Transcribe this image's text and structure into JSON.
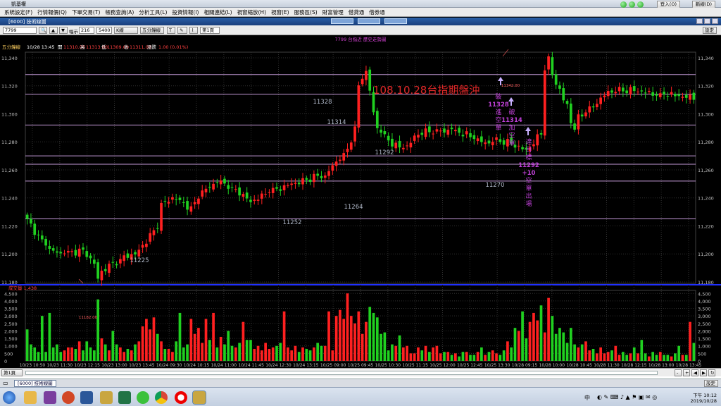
{
  "window": {
    "title": "凱基權",
    "sub_title": "[6000] 技術線圖",
    "settings_btn": "設定"
  },
  "menu": [
    "系統設定(F)",
    "行情報價(Q)",
    "下單交易(T)",
    "帳務查詢(A)",
    "分析工具(L)",
    "投資情報(I)",
    "相關連結(L)",
    "視窗縮放(H)",
    "視窗(E)",
    "服務區(S)",
    "財富管理",
    "借貸通",
    "借券通"
  ],
  "top_buttons": {
    "login": "登入(O)",
    "logout": "斷線(D)"
  },
  "toolbar": {
    "symbol": "7799",
    "period_label": "幅示",
    "bars": "216",
    "bars2": "5400",
    "kline": "K線",
    "freq": "五分鐘線",
    "sheet": "第1頁",
    "settings": "設定"
  },
  "chart_header": "7799 台指近  歷史走勢圖",
  "info_line": {
    "freq": "五分鐘線",
    "time": "10/28 13:45",
    "open_label": "開",
    "open": "11310.00",
    "high_label": "高",
    "high": "11313.00",
    "low_label": "低",
    "low": "11309.00",
    "close_label": "收",
    "close": "11311.00",
    "chg_label": "漲跌",
    "chg": "1.00 (0.01%)"
  },
  "annotation_title": "108.10.28台指期盤沖",
  "annotations": {
    "break_1328": [
      "破",
      "11328",
      "進",
      "空",
      "單"
    ],
    "break_1314": [
      "破",
      "11314",
      "加",
      "空",
      "單"
    ],
    "target": [
      "達",
      "目",
      "標",
      "11292",
      "+10",
      "空",
      "單",
      "出",
      "場"
    ]
  },
  "price_labels": [
    {
      "text": "11328",
      "x": 458,
      "y": 97
    },
    {
      "text": "11314",
      "x": 478,
      "y": 126
    },
    {
      "text": "11292",
      "x": 546,
      "y": 169
    },
    {
      "text": "11270",
      "x": 703,
      "y": 215
    },
    {
      "text": "11264",
      "x": 502,
      "y": 246
    },
    {
      "text": "11252",
      "x": 415,
      "y": 268
    },
    {
      "text": "11225",
      "x": 198,
      "y": 322
    },
    {
      "text": "11182.00",
      "x": 125,
      "y": 402
    },
    {
      "text": "11342.00",
      "x": 725,
      "y": 73
    }
  ],
  "volume_label": "成交量 1,438",
  "y_ticks": [
    "11,340",
    "11,320",
    "11,300",
    "11,280",
    "11,260",
    "11,240",
    "11,220",
    "11,200",
    "11,180"
  ],
  "vol_ticks": [
    "4,500",
    "4,000",
    "3,500",
    "3,000",
    "2,500",
    "2,000",
    "1,500",
    "1,000",
    "500",
    "0"
  ],
  "x_ticks": [
    "10/23 10:50",
    "10/23 11:30",
    "10/23 12:15",
    "10/23 13:00",
    "10/23 13:45",
    "10/24 09:30",
    "10/24 10:15",
    "10/24 11:00",
    "10/24 11:45",
    "10/24 12:30",
    "10/24 13:15",
    "10/25 09:00",
    "10/25 09:45",
    "10/25 10:30",
    "10/25 11:15",
    "10/25 12:00",
    "10/25 12:45",
    "10/25 13:30",
    "10/28 09:15",
    "10/28 10:00",
    "10/28 10:45",
    "10/28 11:30",
    "10/28 12:15",
    "10/28 13:00",
    "10/28 13:45"
  ],
  "status_page": "第1頁",
  "bottom_tab": "[6000] 技術線圖",
  "clock": {
    "time": "下午 10:12",
    "date": "2019/10/28"
  },
  "taskbar_tray": "中",
  "chart_data": {
    "type": "candlestick",
    "title": "7799 台指近 歷史走勢圖",
    "ylim": [
      11180,
      11345
    ],
    "volume_ylim": [
      0,
      4700
    ],
    "horizontal_lines": [
      11328,
      11314,
      11292,
      11270,
      11264,
      11252,
      11225
    ],
    "anchors": [
      [
        0,
        11225
      ],
      [
        3,
        11212
      ],
      [
        6,
        11203
      ],
      [
        9,
        11200
      ],
      [
        12,
        11201
      ],
      [
        15,
        11203
      ],
      [
        18,
        11193
      ],
      [
        19,
        11182
      ],
      [
        20,
        11188
      ],
      [
        23,
        11193
      ],
      [
        26,
        11198
      ],
      [
        29,
        11200
      ],
      [
        31,
        11206
      ],
      [
        33,
        11213
      ],
      [
        34,
        11216
      ],
      [
        35,
        11218
      ],
      [
        36,
        11235
      ],
      [
        39,
        11240
      ],
      [
        42,
        11236
      ],
      [
        44,
        11232
      ],
      [
        46,
        11242
      ],
      [
        49,
        11248
      ],
      [
        51,
        11252
      ],
      [
        54,
        11249
      ],
      [
        57,
        11244
      ],
      [
        60,
        11237
      ],
      [
        62,
        11240
      ],
      [
        65,
        11244
      ],
      [
        68,
        11247
      ],
      [
        71,
        11250
      ],
      [
        74,
        11252
      ],
      [
        77,
        11255
      ],
      [
        80,
        11256
      ],
      [
        83,
        11266
      ],
      [
        86,
        11275
      ],
      [
        88,
        11289
      ],
      [
        89,
        11320
      ],
      [
        91,
        11330
      ],
      [
        92,
        11317
      ],
      [
        93,
        11300
      ],
      [
        94,
        11290
      ],
      [
        96,
        11283
      ],
      [
        98,
        11279
      ],
      [
        100,
        11276
      ],
      [
        102,
        11277
      ],
      [
        104,
        11283
      ],
      [
        106,
        11287
      ],
      [
        108,
        11287
      ],
      [
        110,
        11289
      ],
      [
        112,
        11287
      ],
      [
        114,
        11290
      ],
      [
        116,
        11287
      ],
      [
        118,
        11285
      ],
      [
        120,
        11282
      ],
      [
        122,
        11280
      ],
      [
        124,
        11279
      ],
      [
        126,
        11281
      ],
      [
        128,
        11280
      ],
      [
        130,
        11279
      ],
      [
        132,
        11276
      ],
      [
        134,
        11274
      ],
      [
        135,
        11276
      ],
      [
        137,
        11283
      ],
      [
        138,
        11286
      ],
      [
        139,
        11333
      ],
      [
        140,
        11341
      ],
      [
        141,
        11328
      ],
      [
        142,
        11322
      ],
      [
        143,
        11317
      ],
      [
        144,
        11310
      ],
      [
        145,
        11307
      ],
      [
        146,
        11294
      ],
      [
        147,
        11290
      ],
      [
        148,
        11297
      ],
      [
        150,
        11301
      ],
      [
        152,
        11305
      ],
      [
        154,
        11311
      ],
      [
        156,
        11315
      ],
      [
        158,
        11317
      ],
      [
        160,
        11316
      ],
      [
        162,
        11317
      ],
      [
        165,
        11316
      ],
      [
        168,
        11314
      ],
      [
        171,
        11315
      ],
      [
        174,
        11313
      ],
      [
        177,
        11312
      ],
      [
        180,
        11311
      ],
      [
        183,
        11310
      ],
      [
        185,
        11311
      ]
    ],
    "volumes": [
      2100,
      1100,
      900,
      600,
      3000,
      600,
      3200,
      900,
      1100,
      600,
      700,
      900,
      900,
      800,
      1300,
      700,
      1300,
      900,
      700,
      4100,
      1500,
      1100,
      700,
      2000,
      1100,
      900,
      600,
      800,
      700,
      1100,
      1300,
      2300,
      2800,
      2100,
      2900,
      1800,
      1300,
      800,
      800,
      600,
      1300,
      3200,
      900,
      1100,
      2800,
      1800,
      2200,
      1200,
      2800,
      1400,
      3200,
      900,
      1600,
      1100,
      2000,
      1000,
      900,
      1200,
      2600,
      1400,
      1400,
      800,
      1000,
      700,
      1200,
      800,
      900,
      1000,
      1200,
      3300,
      900,
      700,
      1000,
      600,
      900,
      800,
      700,
      900,
      1200,
      1000,
      1000,
      3300,
      700,
      3000,
      3400,
      2800,
      4500,
      3000,
      2500,
      3300,
      1800,
      2600,
      3600,
      3200,
      2900,
      1800,
      1900,
      700,
      1100,
      1000,
      1700,
      900,
      1000,
      500,
      500,
      900,
      700,
      1000,
      600,
      900,
      1000,
      500,
      600,
      600,
      400,
      500,
      300,
      600,
      600,
      400,
      400,
      600,
      900,
      400,
      600,
      700,
      500,
      400,
      700,
      1300,
      900,
      2200,
      2000,
      3300,
      1500,
      2600,
      3200,
      2700,
      3700,
      1900,
      4200,
      3000,
      1800,
      2200,
      1900,
      1200,
      2200,
      1100,
      900,
      1100,
      1300,
      700,
      800,
      500,
      900,
      500,
      600,
      700,
      1000,
      400,
      600,
      400,
      500,
      900,
      500,
      1400,
      500,
      300,
      600,
      400,
      600,
      400,
      400,
      300,
      500,
      1000,
      400,
      400,
      2600,
      1200
    ]
  }
}
